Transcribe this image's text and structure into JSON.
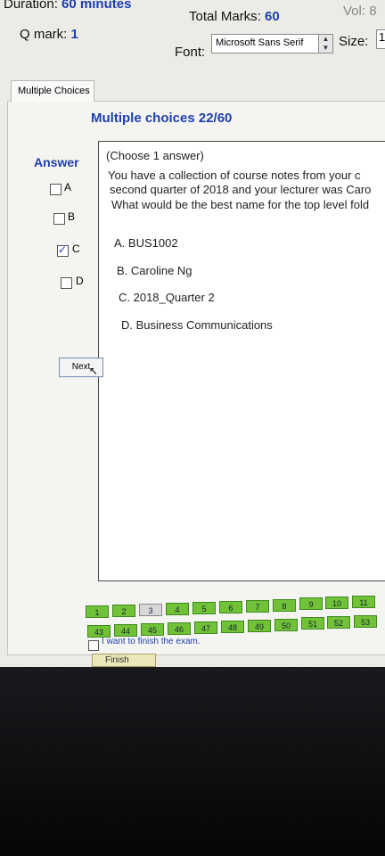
{
  "header": {
    "duration_label": "Duration:",
    "duration_value": "60 minutes",
    "qmark_label": "Q mark:",
    "qmark_value": "1",
    "total_label": "Total Marks:",
    "total_value": "60",
    "vol_label": "Vol:",
    "vol_value": "8",
    "font_label": "Font:",
    "font_value": "Microsoft Sans Serif",
    "size_label": "Size:",
    "size_value": "1"
  },
  "tab_label": "Multiple Choices",
  "panel_title": "Multiple choices 22/60",
  "answer_label": "Answer",
  "answer_options": [
    {
      "label": "A",
      "checked": false
    },
    {
      "label": "B",
      "checked": false
    },
    {
      "label": "C",
      "checked": true
    },
    {
      "label": "D",
      "checked": false
    }
  ],
  "question": {
    "instruction": "(Choose 1 answer)",
    "lines": [
      "You have a collection of course notes from your c",
      "second quarter of 2018 and your lecturer was Caro",
      "What would be the best name for the top level fold"
    ],
    "choices": [
      "A. BUS1002",
      "B. Caroline Ng",
      "C. 2018_Quarter 2",
      "D. Business Communications"
    ]
  },
  "next_label": "Next",
  "question_nav": {
    "row1": [
      "1",
      "2",
      "3",
      "4",
      "5",
      "6",
      "7",
      "8",
      "9",
      "10",
      "11"
    ],
    "row2": [
      "43",
      "44",
      "45",
      "46",
      "47",
      "48",
      "49",
      "50",
      "51",
      "52",
      "53"
    ],
    "current": "3"
  },
  "finish_check_label": "I want to finish the exam.",
  "finish_label": "Finish"
}
